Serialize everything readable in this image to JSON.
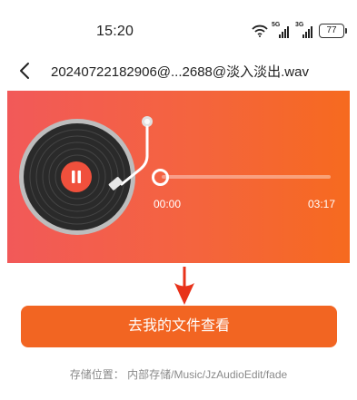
{
  "status_bar": {
    "time": "15:20",
    "signal_labels": [
      "5G",
      "3G"
    ],
    "battery": "77",
    "icons": [
      "wifi-icon",
      "signal-5g-icon",
      "signal-3g-icon",
      "battery-icon"
    ]
  },
  "nav": {
    "back_icon": "chevron-left-icon",
    "title": "20240722182906@...2688@淡入淡出.wav"
  },
  "player": {
    "gradient_start": "#f25959",
    "gradient_end": "#f66a1f",
    "state": "playing",
    "play_button_icon": "pause-icon",
    "current_time": "00:00",
    "duration": "03:17",
    "progress": 0
  },
  "pointer_arrow_color": "#e8321a",
  "action_button": {
    "label": "去我的文件查看",
    "color": "#f26522"
  },
  "storage": {
    "label": "存储位置：",
    "path": "内部存储/Music/JzAudioEdit/fade"
  }
}
